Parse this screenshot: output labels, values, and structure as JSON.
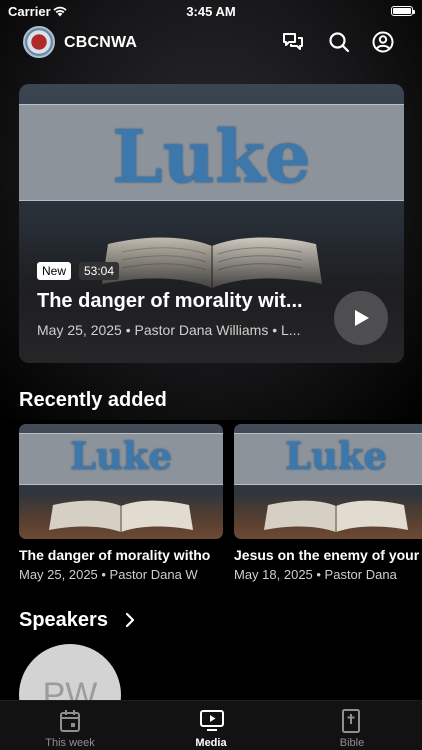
{
  "status_bar": {
    "carrier": "Carrier",
    "time": "3:45 AM"
  },
  "header": {
    "app_title": "CBCNWA",
    "icons": [
      "chat-bubbles-icon",
      "search-icon",
      "account-icon"
    ]
  },
  "hero": {
    "series_art": "Luke",
    "badge_new": "New",
    "duration": "53:04",
    "title": "The danger of morality wit...",
    "subtitle": "May 25, 2025 • Pastor Dana Williams • L..."
  },
  "recently_added": {
    "heading": "Recently added",
    "items": [
      {
        "art": "Luke",
        "title": "The danger of morality witho",
        "subtitle": "May 25, 2025 • Pastor Dana W"
      },
      {
        "art": "Luke",
        "title": "Jesus on the enemy of your",
        "subtitle": "May 18, 2025 • Pastor Dana"
      }
    ]
  },
  "speakers": {
    "heading": "Speakers",
    "items": [
      {
        "initials": "PW"
      }
    ]
  },
  "tab_bar": {
    "tabs": [
      {
        "label": "This week",
        "icon": "calendar-icon",
        "active": false
      },
      {
        "label": "Media",
        "icon": "tv-play-icon",
        "active": true
      },
      {
        "label": "Bible",
        "icon": "bible-icon",
        "active": false
      }
    ]
  }
}
